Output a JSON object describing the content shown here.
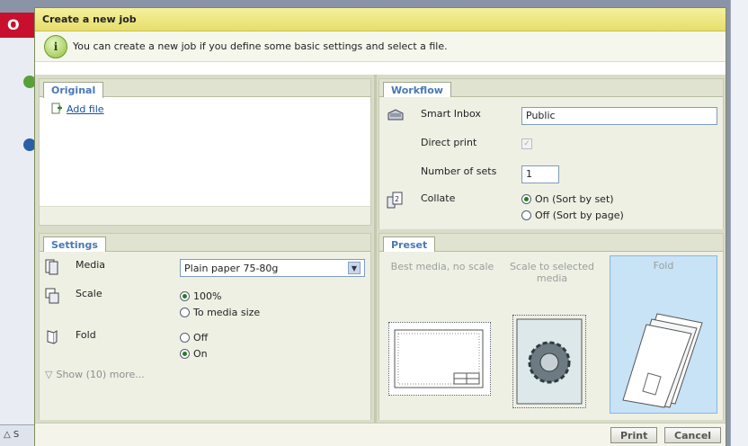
{
  "background_app": {
    "logo": "O",
    "status": "△ S"
  },
  "dialog": {
    "title": "Create a new job",
    "info_text": "You can create a new job if you define some basic settings and select a file.",
    "info_icon_glyph": "i"
  },
  "original": {
    "tab": "Original",
    "add_file": "Add file"
  },
  "workflow": {
    "tab": "Workflow",
    "smart_inbox_label": "Smart Inbox",
    "smart_inbox_value": "Public",
    "direct_print_label": "Direct print",
    "direct_print_checked": true,
    "direct_print_enabled": false,
    "sets_label": "Number of sets",
    "sets_value": "1",
    "collate_label": "Collate",
    "collate_on": "On (Sort by set)",
    "collate_off": "Off (Sort by page)",
    "collate_selected": "on"
  },
  "settings": {
    "tab": "Settings",
    "media_label": "Media",
    "media_value": "Plain paper 75-80g",
    "scale_label": "Scale",
    "scale_100": "100%",
    "scale_fit": "To media size",
    "scale_selected": "100%",
    "fold_label": "Fold",
    "fold_off": "Off",
    "fold_on": "On",
    "fold_selected": "on",
    "show_more": "Show (10) more..."
  },
  "preset": {
    "tab": "Preset",
    "items": [
      {
        "label": "Best media, no scale",
        "selected": false
      },
      {
        "label": "Scale to selected media",
        "selected": false
      },
      {
        "label": "Fold",
        "selected": true
      }
    ]
  },
  "footer": {
    "print": "Print",
    "cancel": "Cancel"
  },
  "colors": {
    "title_bar": "#e6de6a",
    "tab_text": "#4a78b4",
    "selected_preset": "#c8e2f6",
    "link": "#1a4fa3"
  }
}
